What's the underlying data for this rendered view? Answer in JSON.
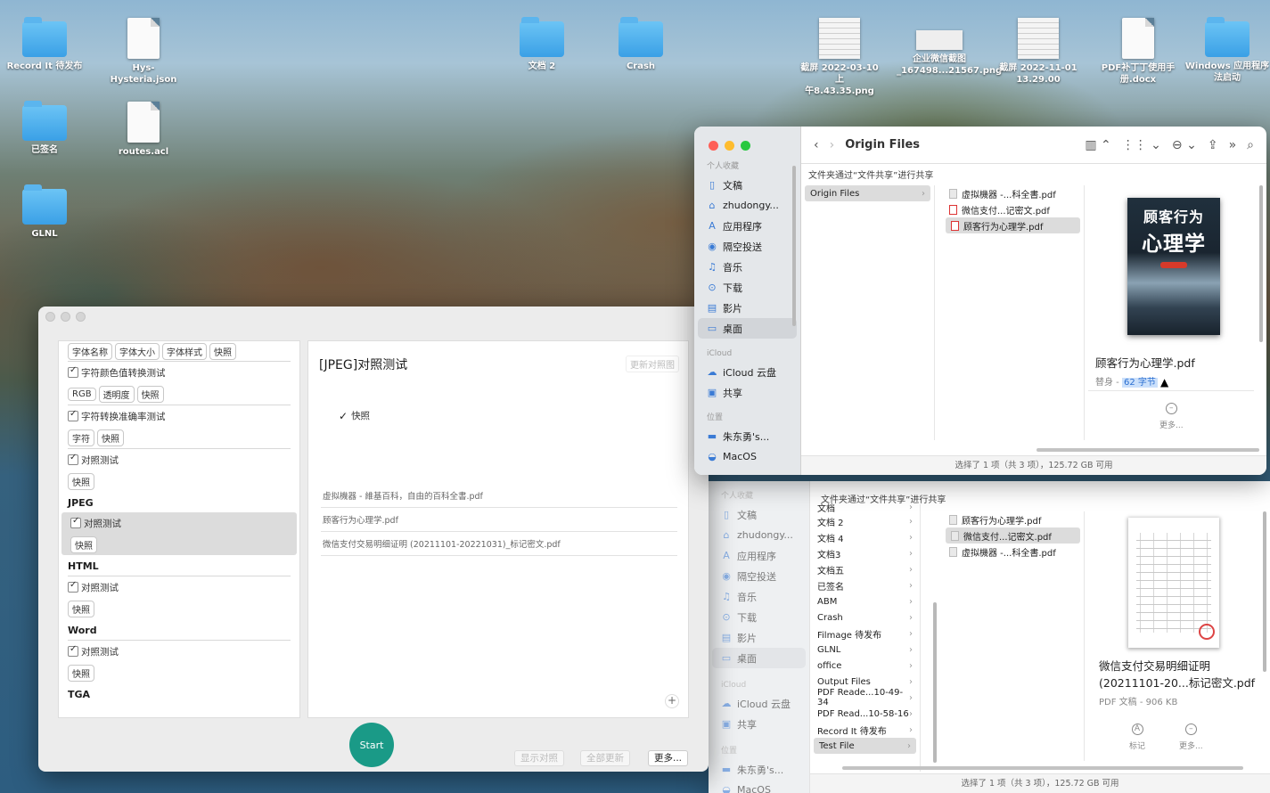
{
  "desktop": {
    "icons": [
      {
        "name": "Record It 待发布",
        "kind": "folder"
      },
      {
        "name": "Hys-Hysteria.json",
        "kind": "doc"
      },
      {
        "name": "文档 2",
        "kind": "folder"
      },
      {
        "name": "Crash",
        "kind": "folder"
      },
      {
        "name": "截屏 2022-03-10 上",
        "name2": "午8.43.35.png",
        "kind": "thumb"
      },
      {
        "name": "企业微信截图",
        "name2": "_167498...21567.png",
        "kind": "thumb-wide"
      },
      {
        "name": "截屏 2022-11-01",
        "name2": "13.29.00",
        "kind": "thumb"
      },
      {
        "name": "PDF补丁丁使用手",
        "name2": "册.docx",
        "kind": "doc"
      },
      {
        "name": "Windows 应用程序",
        "name2": "法启动",
        "kind": "folder"
      },
      {
        "name": "已签名",
        "kind": "folder"
      },
      {
        "name": "routes.acl",
        "kind": "doc"
      },
      {
        "name": "GLNL",
        "kind": "folder"
      }
    ]
  },
  "app": {
    "left": {
      "top_tags": [
        "字体名称",
        "字体大小",
        "字体样式",
        "快照"
      ],
      "color_check": "字符颜色值转换测试",
      "color_tags": [
        "RGB",
        "透明度",
        "快照"
      ],
      "accuracy_check": "字符转换准确率测试",
      "accuracy_tags": [
        "字符",
        "快照"
      ],
      "compare_check": "对照测试",
      "snapshot_tag": "快照",
      "sections": [
        {
          "title": "JPEG",
          "check": "对照测试",
          "tag": "快照"
        },
        {
          "title": "HTML",
          "check": "对照测试",
          "tag": "快照"
        },
        {
          "title": "Word",
          "check": "对照测试",
          "tag": "快照"
        },
        {
          "title": "TGA"
        }
      ]
    },
    "right": {
      "title": "[JPEG]对照测试",
      "update_button": "更新对照图",
      "snapshot_label": "快照",
      "files": [
        "虚拟機器 - 維基百科，自由的百科全書.pdf",
        "顾客行为心理学.pdf",
        "微信支付交易明细证明 (20211101-20221031)_标记密文.pdf"
      ],
      "plus": "+"
    },
    "start_label": "Start",
    "bottom_buttons": [
      "显示对照",
      "全部更新",
      "更多..."
    ]
  },
  "finder1": {
    "title": "Origin Files",
    "path_note": "文件夹通过“文件共享”进行共享",
    "sidebar": {
      "fav_head": "个人收藏",
      "favorites": [
        {
          "icon": "document-icon",
          "label": "文稿"
        },
        {
          "icon": "home-icon",
          "label": "zhudongy..."
        },
        {
          "icon": "apps-icon",
          "label": "应用程序"
        },
        {
          "icon": "airdrop-icon",
          "label": "隔空投送"
        },
        {
          "icon": "music-icon",
          "label": "音乐"
        },
        {
          "icon": "download-icon",
          "label": "下载"
        },
        {
          "icon": "movie-icon",
          "label": "影片"
        },
        {
          "icon": "desktop-icon",
          "label": "桌面"
        }
      ],
      "icloud_head": "iCloud",
      "icloud": [
        {
          "icon": "cloud-icon",
          "label": "iCloud 云盘"
        },
        {
          "icon": "shared-icon",
          "label": "共享"
        }
      ],
      "loc_head": "位置",
      "locations": [
        {
          "icon": "computer-icon",
          "label": "朱东勇's..."
        },
        {
          "icon": "disk-icon",
          "label": "MacOS"
        }
      ]
    },
    "col1": [
      "Origin Files"
    ],
    "col2": [
      "虚拟機器 -...科全書.pdf",
      "微信支付...记密文.pdf",
      "顾客行为心理学.pdf"
    ],
    "preview": {
      "cover_line1": "顾客行为",
      "cover_line2": "心理学",
      "title": "顾客行为心理学.pdf",
      "sub_prefix": "替身 - ",
      "sub_size": "62 字节",
      "more": "更多..."
    },
    "status": "选择了 1 项（共 3 项），125.72 GB 可用"
  },
  "finder2": {
    "path_note": "文件夹通过“文件共享”进行共享",
    "sidebar": {
      "fav_head": "个人收藏",
      "favorites": [
        {
          "icon": "document-icon",
          "label": "文稿"
        },
        {
          "icon": "home-icon",
          "label": "zhudongy..."
        },
        {
          "icon": "apps-icon",
          "label": "应用程序"
        },
        {
          "icon": "airdrop-icon",
          "label": "隔空投送"
        },
        {
          "icon": "music-icon",
          "label": "音乐"
        },
        {
          "icon": "download-icon",
          "label": "下载"
        },
        {
          "icon": "movie-icon",
          "label": "影片"
        },
        {
          "icon": "desktop-icon",
          "label": "桌面"
        }
      ],
      "icloud_head": "iCloud",
      "icloud": [
        {
          "icon": "cloud-icon",
          "label": "iCloud 云盘"
        },
        {
          "icon": "shared-icon",
          "label": "共享"
        }
      ],
      "loc_head": "位置",
      "locations": [
        {
          "icon": "computer-icon",
          "label": "朱东勇's..."
        },
        {
          "icon": "disk-icon",
          "label": "MacOS"
        }
      ]
    },
    "col1": [
      "文档",
      "文档 2",
      "文档 4",
      "文档3",
      "文档五",
      "已签名",
      "ABM",
      "Crash",
      "Filmage 待发布",
      "GLNL",
      "office",
      "Output Files",
      "PDF Reade...10-49-34",
      "PDF Read...10-58-16",
      "Record It 待发布",
      "Test File"
    ],
    "col2": [
      "顾客行为心理学.pdf",
      "微信支付...记密文.pdf",
      "虚拟機器 -...科全書.pdf"
    ],
    "preview": {
      "title1": "微信支付交易明细证明",
      "title2": "(20211101-20...标记密文.pdf",
      "sub": "PDF 文稿 - 906 KB",
      "actions": [
        "标记",
        "更多..."
      ]
    },
    "status": "选择了 1 项（共 3 项），125.72 GB 可用"
  }
}
